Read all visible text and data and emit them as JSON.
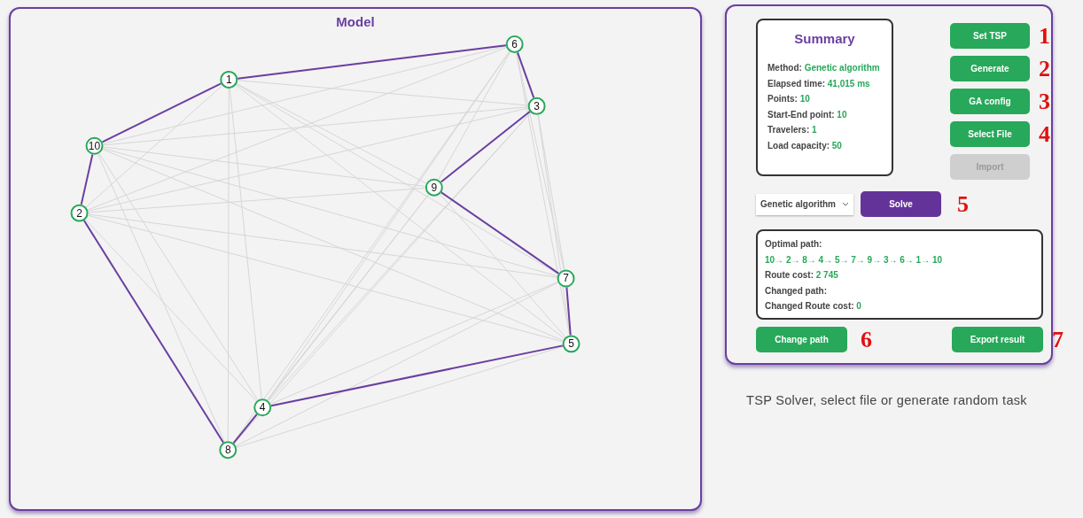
{
  "model": {
    "title": "Model",
    "nodes": [
      {
        "label": "10"
      },
      {
        "label": "2"
      },
      {
        "label": "8"
      },
      {
        "label": "4"
      },
      {
        "label": "5"
      },
      {
        "label": "7"
      },
      {
        "label": "9"
      },
      {
        "label": "3"
      },
      {
        "label": "6"
      },
      {
        "label": "1"
      }
    ]
  },
  "summary": {
    "title": "Summary",
    "fields": [
      {
        "label": "Method:",
        "value": "Genetic algorithm"
      },
      {
        "label": "Elapsed time:",
        "value": "41,015 ms"
      },
      {
        "label": "Points:",
        "value": "10"
      },
      {
        "label": "Start-End point:",
        "value": "10"
      },
      {
        "label": "Travelers:",
        "value": "1"
      },
      {
        "label": "Load capacity:",
        "value": "50"
      }
    ]
  },
  "actions": [
    {
      "label": "Set TSP",
      "disabled": false,
      "marker": "1"
    },
    {
      "label": "Generate",
      "disabled": false,
      "marker": "2"
    },
    {
      "label": "GA config",
      "disabled": false,
      "marker": "3"
    },
    {
      "label": "Select File",
      "disabled": false,
      "marker": "4"
    },
    {
      "label": "Import",
      "disabled": true
    }
  ],
  "method_select": {
    "value": "Genetic algorithm"
  },
  "solve": {
    "label": "Solve",
    "marker": "5"
  },
  "result": {
    "fields": [
      {
        "kind": "stacked",
        "label": "Optimal path:",
        "value": "10→ 2→ 8→ 4→ 5→ 7→ 9→ 3→ 6→ 1→ 10"
      },
      {
        "kind": "inline",
        "label": "Route cost:",
        "value": "2 745"
      },
      {
        "kind": "inline",
        "label": "Changed path:"
      },
      {
        "kind": "inline",
        "label": "Changed Route cost:",
        "value": "0"
      }
    ]
  },
  "change_path": {
    "label": "Change path",
    "marker": "6"
  },
  "export": {
    "label": "Export result",
    "marker": "7"
  },
  "status": "TSP Solver, select file or generate random task"
}
